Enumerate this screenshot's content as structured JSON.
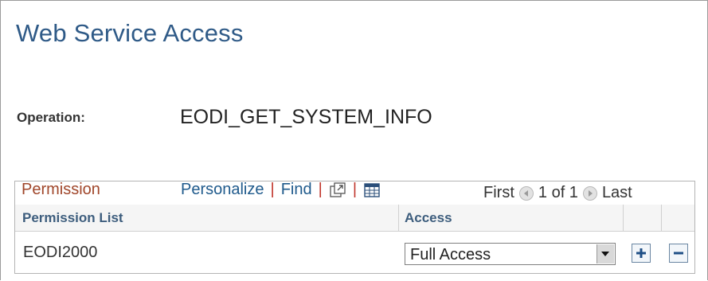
{
  "page": {
    "title": "Web Service Access"
  },
  "operation": {
    "label": "Operation:",
    "value": "EODI_GET_SYSTEM_INFO"
  },
  "grid": {
    "title": "Permission",
    "personalize_label": "Personalize",
    "find_label": "Find",
    "separator": "|",
    "nav": {
      "first_label": "First",
      "range_label": "1 of 1",
      "last_label": "Last"
    },
    "columns": [
      "Permission List",
      "Access"
    ],
    "rows": [
      {
        "permission_list": "EODI2000",
        "access": "Full Access"
      }
    ]
  },
  "colors": {
    "title_blue": "#2f5a87",
    "grid_title": "#a0462a",
    "link_blue": "#1f5a8c",
    "separator_red": "#c0352b"
  },
  "icons": [
    "new-window-icon",
    "download-grid-icon",
    "previous-arrow-icon",
    "next-arrow-icon",
    "dropdown-arrow-icon",
    "add-row-icon",
    "delete-row-icon"
  ]
}
